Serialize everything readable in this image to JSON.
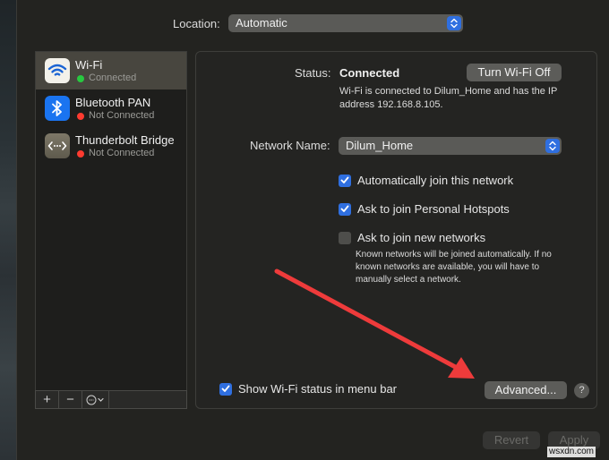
{
  "location": {
    "label": "Location:",
    "value": "Automatic"
  },
  "services": [
    {
      "name": "Wi-Fi",
      "state": "Connected",
      "icon": "wifi-icon",
      "status_color": "#28c840",
      "selected": true
    },
    {
      "name": "Bluetooth PAN",
      "state": "Not Connected",
      "icon": "bluetooth-icon",
      "status_color": "#ff3b30",
      "selected": false
    },
    {
      "name": "Thunderbolt Bridge",
      "state": "Not Connected",
      "icon": "thunderbolt-bridge-icon",
      "status_color": "#ff3b30",
      "selected": false
    }
  ],
  "sidebar_toolbar": {
    "add": "+",
    "remove": "−",
    "action": "⊖⌄"
  },
  "detail": {
    "status_label": "Status:",
    "status_value": "Connected",
    "turn_off_label": "Turn Wi-Fi Off",
    "status_description": "Wi-Fi is connected to Dilum_Home and has the IP address 192.168.8.105.",
    "network_name_label": "Network Name:",
    "network_name_value": "Dilum_Home",
    "checkboxes": [
      {
        "label": "Automatically join this network",
        "checked": true
      },
      {
        "label": "Ask to join Personal Hotspots",
        "checked": true
      },
      {
        "label": "Ask to join new networks",
        "checked": false
      }
    ],
    "help_text": "Known networks will be joined automatically. If no known networks are available, you will have to manually select a network.",
    "show_status_label": "Show Wi-Fi status in menu bar",
    "show_status_checked": true,
    "advanced_label": "Advanced...",
    "help_label": "?"
  },
  "footer": {
    "revert_label": "Revert",
    "apply_label": "Apply"
  },
  "annotation": {
    "arrow_color": "#ee3b3b"
  },
  "watermark": "wsxdn.com",
  "colors": {
    "accent": "#2f6fe0",
    "connected": "#28c840",
    "disconnected": "#ff3b30"
  }
}
